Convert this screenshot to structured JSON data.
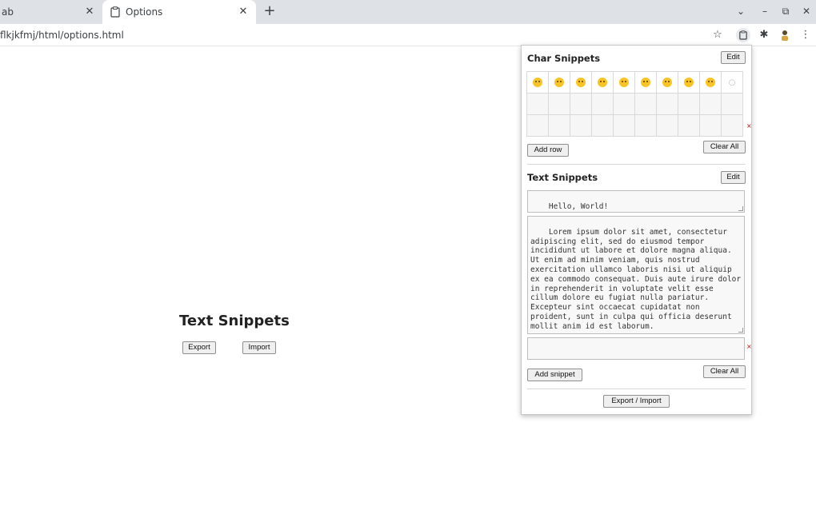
{
  "browser": {
    "tabs": [
      {
        "label": "ab",
        "active": false
      },
      {
        "label": "Options",
        "active": true
      }
    ],
    "url": "flkjkfmj/html/options.html"
  },
  "page": {
    "title": "Text Snippets",
    "export_label": "Export",
    "import_label": "Import"
  },
  "popup": {
    "char_section": {
      "title": "Char Snippets",
      "edit_label": "Edit",
      "emoji_row": [
        "grinning",
        "smiley",
        "smile",
        "grin",
        "laughing",
        "sweat-smile",
        "joy",
        "rofl",
        "slight-smile",
        "plus"
      ],
      "add_row_label": "Add row",
      "clear_all_label": "Clear All"
    },
    "text_section": {
      "title": "Text Snippets",
      "edit_label": "Edit",
      "snippets": [
        "Hello, World!",
        "Lorem ipsum dolor sit amet, consectetur adipiscing elit, sed do eiusmod tempor incididunt ut labore et dolore magna aliqua. Ut enim ad minim veniam, quis nostrud exercitation ullamco laboris nisi ut aliquip ex ea commodo consequat. Duis aute irure dolor in reprehenderit in voluptate velit esse cillum dolore eu fugiat nulla pariatur. Excepteur sint occaecat cupidatat non proident, sunt in culpa qui officia deserunt mollit anim id est laborum.",
        ""
      ],
      "add_snippet_label": "Add snippet",
      "clear_all_label": "Clear All"
    },
    "export_import_label": "Export / Import"
  }
}
